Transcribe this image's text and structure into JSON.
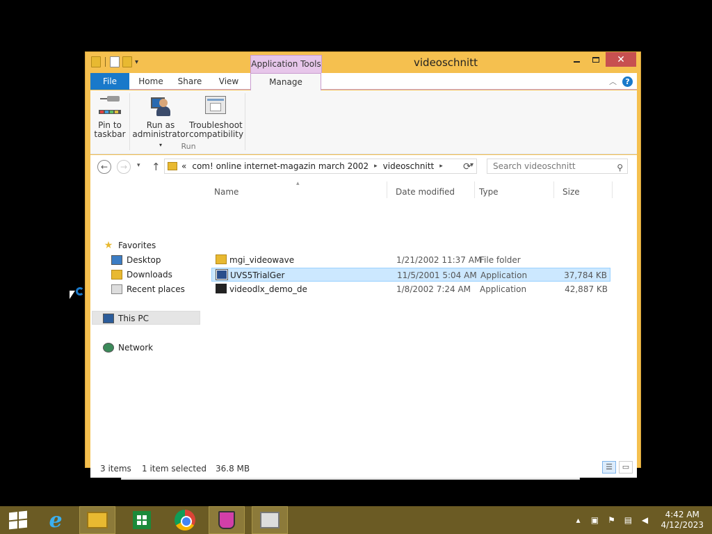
{
  "window": {
    "title": "videoschnitt",
    "contextual_tab": "Application Tools",
    "close_glyph": "✕"
  },
  "ribbon": {
    "tabs": {
      "file": "File",
      "home": "Home",
      "share": "Share",
      "view": "View",
      "manage": "Manage"
    },
    "buttons": {
      "pin_line1": "Pin to",
      "pin_line2": "taskbar",
      "run_line1": "Run as",
      "run_line2": "administrator",
      "troubleshoot_line1": "Troubleshoot",
      "troubleshoot_line2": "compatibility"
    },
    "group_label": "Run"
  },
  "address": {
    "overflow": "«",
    "crumbs": [
      "com! online internet-magazin march 2002",
      "videoschnitt"
    ],
    "search_placeholder": "Search videoschnitt"
  },
  "nav_pane": {
    "favorites": "Favorites",
    "desktop": "Desktop",
    "downloads": "Downloads",
    "recent": "Recent places",
    "this_pc": "This PC",
    "network": "Network"
  },
  "columns": {
    "name": "Name",
    "date": "Date modified",
    "type": "Type",
    "size": "Size"
  },
  "files": [
    {
      "name": "mgi_videowave",
      "date": "1/21/2002 11:37 AM",
      "type": "File folder",
      "size": "",
      "icon": "folder-icon",
      "selected": false
    },
    {
      "name": "UVS5TrialGer",
      "date": "11/5/2001 5:04 AM",
      "type": "Application",
      "size": "37,784 KB",
      "icon": "application-icon",
      "selected": true
    },
    {
      "name": "videodlx_demo_de",
      "date": "1/8/2002 7:24 AM",
      "type": "Application",
      "size": "42,887 KB",
      "icon": "application-icon",
      "selected": false
    }
  ],
  "status": {
    "items": "3 items",
    "selected": "1 item selected",
    "size": "36.8 MB"
  },
  "taskbar": {
    "time": "4:42 AM",
    "date": "4/12/2023"
  }
}
